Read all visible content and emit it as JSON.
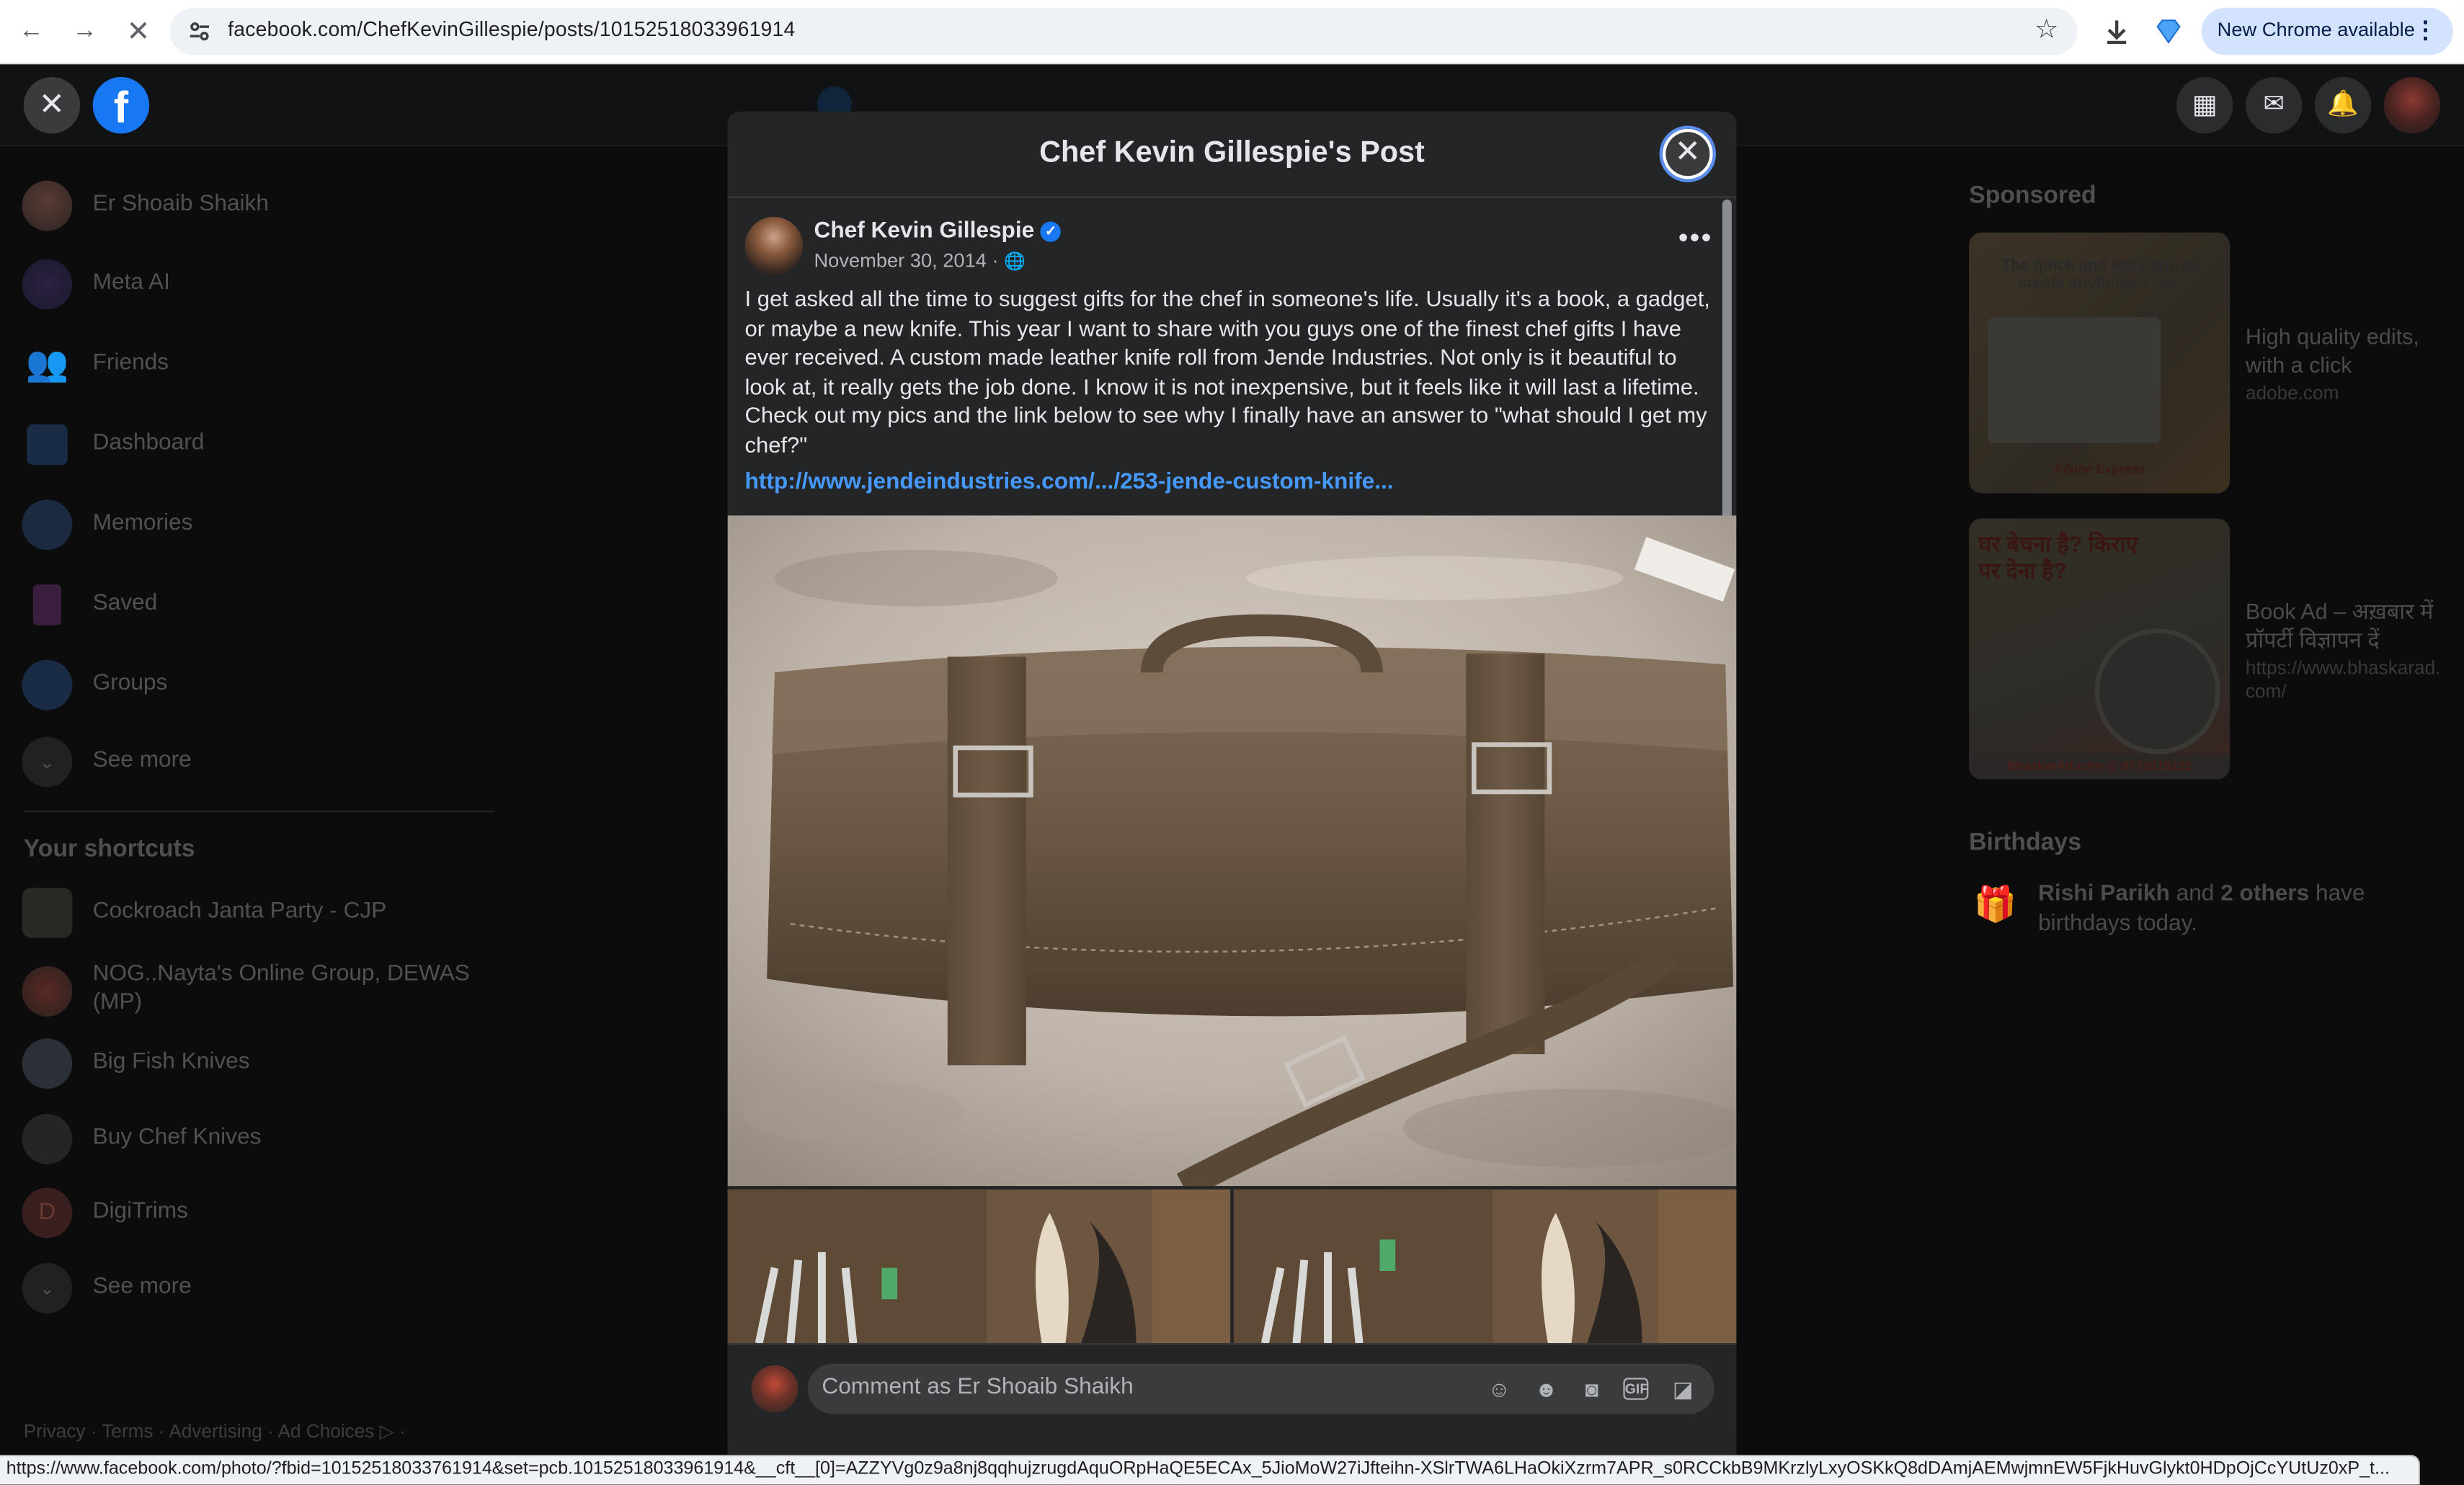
{
  "browser": {
    "url": "facebook.com/ChefKevinGillespie/posts/10152518033961914",
    "update_label": "New Chrome available",
    "status_url": "https://www.facebook.com/photo/?fbid=10152518033761914&set=pcb.10152518033961914&__cft__[0]=AZZYVg0z9a8nj8qqhujzrugdAquORpHaQE5ECAx_5JioMoW27iJfteihn-XSlrTWA6LHaOkiXzrm7APR_s0RCCkbB9MKrzlyLxyOSKkQ8dDAmjAEMwjmnEW5FjkHuvGlykt0HDpOjCcYUtUz0xP_t..."
  },
  "left_nav": {
    "items": [
      {
        "label": "Er Shoaib Shaikh",
        "icon": "profile-avatar"
      },
      {
        "label": "Meta AI",
        "icon": "meta-ai-icon"
      },
      {
        "label": "Friends",
        "icon": "friends-icon"
      },
      {
        "label": "Dashboard",
        "icon": "dashboard-icon"
      },
      {
        "label": "Memories",
        "icon": "memories-icon"
      },
      {
        "label": "Saved",
        "icon": "saved-icon"
      },
      {
        "label": "Groups",
        "icon": "groups-icon"
      },
      {
        "label": "See more",
        "icon": "chevron-down-icon"
      }
    ],
    "shortcuts_title": "Your shortcuts",
    "shortcuts": [
      {
        "label": "Cockroach Janta Party - CJP"
      },
      {
        "label": "NOG..Nayta's Online Group, DEWAS (MP)"
      },
      {
        "label": "Big Fish Knives"
      },
      {
        "label": "Buy Chef Knives"
      },
      {
        "label": "DigiTrims",
        "initial": "D"
      },
      {
        "label": "See more"
      }
    ],
    "footer": "Privacy · Terms · Advertising · Ad Choices ▷ ·"
  },
  "right_rail": {
    "sponsored_title": "Sponsored",
    "ads": [
      {
        "title": "High quality edits, with a click",
        "domain": "adobe.com",
        "image_caption": "The quick and easy app to create anything. Free.",
        "brand": "Adobe Express"
      },
      {
        "title": "Book Ad – अख़बार में प्रॉपर्टी विज्ञापन दें",
        "domain": "https://www.bhaskarad.com/",
        "image_caption": "घर बेचना है? किराए पर देना है?",
        "brand": "BhaskarAd.com @ 9772019222"
      }
    ],
    "birthdays_title": "Birthdays",
    "birthday_name": "Rishi Parikh",
    "birthday_and": "and",
    "birthday_others": "2 others",
    "birthday_suffix": "have birthdays today."
  },
  "modal": {
    "title": "Chef Kevin Gillespie's Post",
    "author": "Chef Kevin Gillespie",
    "date": "November 30, 2014 ·",
    "text": "I get asked all the time to suggest gifts for the chef in someone's life. Usually it's a book, a gadget, or maybe a new knife. This year I want to share with you guys one of the finest chef gifts I have ever received. A custom made leather knife roll from Jende Industries. Not only is it beautiful to look at, it really gets the job done. I know it is not inexpensive, but it feels like it will last a lifetime. Check out my pics and the link below to see why I finally have an answer to \"what should I get my chef?\"",
    "link": "http://www.jendeindustries.com/.../253-jende-custom-knife...",
    "comment_placeholder": "Comment as Er Shoaib Shaikh"
  },
  "colors": {
    "accent": "#1877f2",
    "link": "#4599ff",
    "modal_bg": "#242526"
  }
}
